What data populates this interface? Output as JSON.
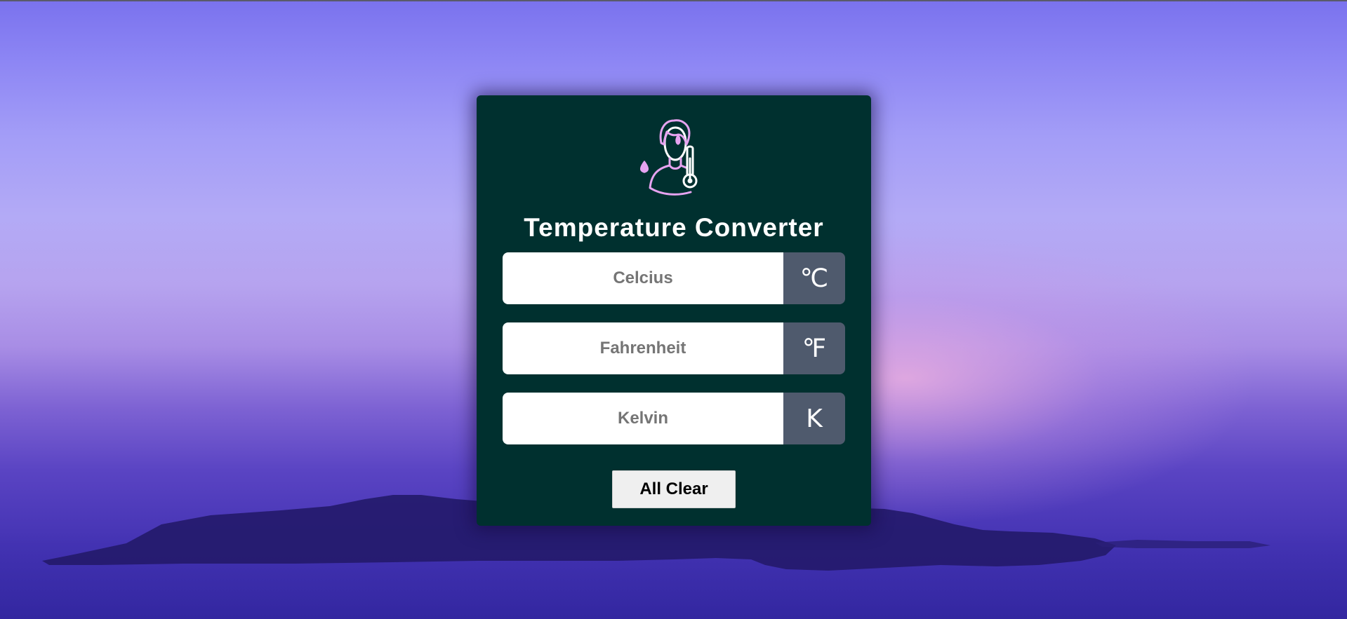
{
  "app": {
    "title": "Temperature Converter",
    "logo_icon": "person-thermometer-sweat-icon"
  },
  "fields": [
    {
      "placeholder": "Celcius",
      "value": "",
      "unit": "℃"
    },
    {
      "placeholder": "Fahrenheit",
      "value": "",
      "unit": "℉"
    },
    {
      "placeholder": "Kelvin",
      "value": "",
      "unit": "K"
    }
  ],
  "actions": {
    "clear_label": "All Clear"
  },
  "colors": {
    "card_bg": "#00302f",
    "unit_bg": "#4f5a6d",
    "icon_stroke": "#e6a3f0",
    "background_sky": "#8d86f4"
  }
}
